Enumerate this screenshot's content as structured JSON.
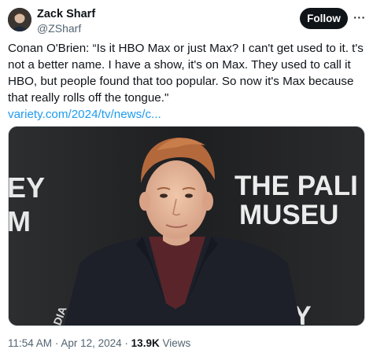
{
  "author": {
    "name": "Zack Sharf",
    "handle": "@ZSharf"
  },
  "actions": {
    "follow_label": "Follow",
    "more_label": "···"
  },
  "tweet": {
    "text": "Conan O'Brien: “Is it HBO Max or just Max? I can't get used to it. t's not a better name. I have a show, it's on Max. They used to call it HBO, but people found that too popular. So now it's Max because that really rolls off the tongue.\"",
    "link": "variety.com/2024/tv/news/c..."
  },
  "media": {
    "backdrop_left_text": [
      "EY",
      "M"
    ],
    "backdrop_right_text": [
      "THE PALI",
      "MUSEU"
    ],
    "bottom_left_text": "DIA",
    "bottom_right_text": "Y"
  },
  "meta": {
    "time": "11:54 AM",
    "separator": "·",
    "date": "Apr 12, 2024",
    "views_count": "13.9K",
    "views_label": "Views"
  },
  "colors": {
    "link": "#1d9bf0",
    "secondary_text": "#536471",
    "follow_bg": "#0f1419"
  }
}
